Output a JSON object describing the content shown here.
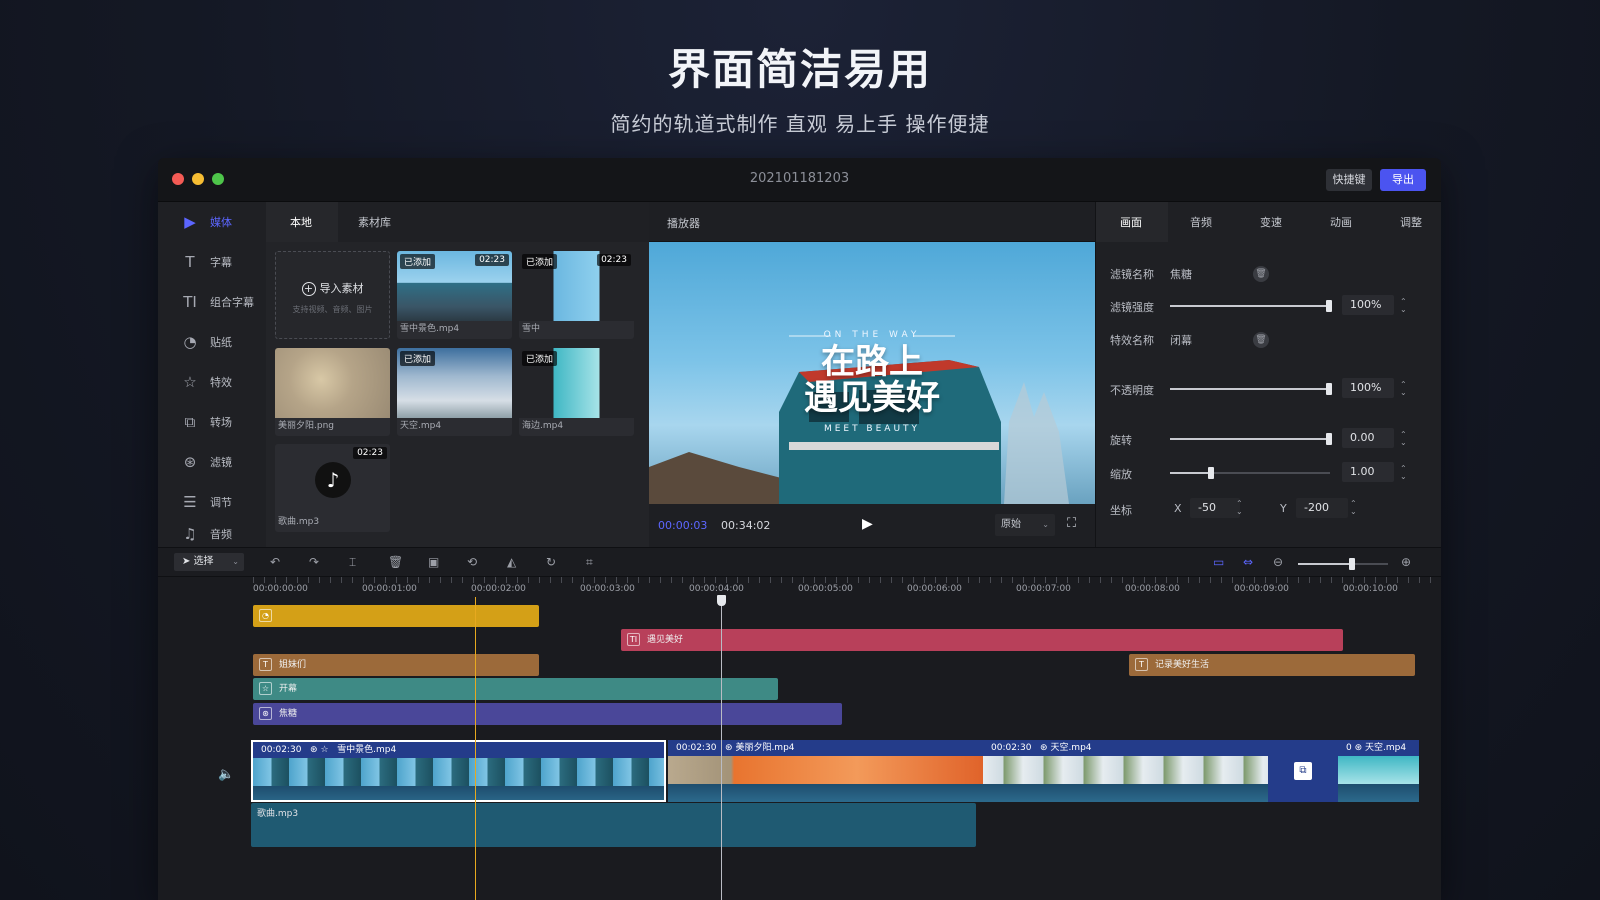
{
  "hero": {
    "title": "界面简洁易用",
    "subtitle": "简约的轨道式制作 直观 易上手 操作便捷"
  },
  "window": {
    "title": "202101181203",
    "shortcut_label": "快捷键",
    "export_label": "导出"
  },
  "sidebar": {
    "items": [
      {
        "label": "媒体",
        "icon": "play-icon",
        "active": true
      },
      {
        "label": "字幕",
        "icon": "text-icon"
      },
      {
        "label": "组合字幕",
        "icon": "combo-text-icon"
      },
      {
        "label": "贴纸",
        "icon": "sticker-icon"
      },
      {
        "label": "特效",
        "icon": "effect-star-icon"
      },
      {
        "label": "转场",
        "icon": "transition-icon"
      },
      {
        "label": "滤镜",
        "icon": "filter-icon"
      },
      {
        "label": "调节",
        "icon": "adjust-icon"
      },
      {
        "label": "音频",
        "icon": "audio-icon"
      }
    ]
  },
  "media": {
    "tabs": [
      "本地",
      "素材库"
    ],
    "import_label": "导入素材",
    "import_hint": "支持视频、音频、图片",
    "items": [
      {
        "name": "雪中景色.mp4",
        "badge": "已添加",
        "duration": "02:23"
      },
      {
        "name": "雪中",
        "badge": "已添加",
        "duration": "02:23"
      },
      {
        "name": "美丽夕阳.png"
      },
      {
        "name": "天空.mp4",
        "badge": "已添加"
      },
      {
        "name": "海边.mp4",
        "badge": "已添加"
      },
      {
        "name": "歌曲.mp3",
        "duration": "02:23"
      }
    ]
  },
  "player": {
    "title": "播放器",
    "overlay_en_top": "ON THE WAY",
    "overlay_cn_line1": "在路上",
    "overlay_cn_line2": "遇见美好",
    "overlay_en_bottom": "MEET BEAUTY",
    "current_time": "00:00:03",
    "total_time": "00:34:02",
    "ratio": "原始"
  },
  "properties": {
    "tabs": [
      "画面",
      "音频",
      "变速",
      "动画",
      "调整"
    ],
    "filter_name_label": "滤镜名称",
    "filter_name_value": "焦糖",
    "filter_strength_label": "滤镜强度",
    "filter_strength_value": "100%",
    "effect_name_label": "特效名称",
    "effect_name_value": "闭幕",
    "opacity_label": "不透明度",
    "opacity_value": "100%",
    "rotate_label": "旋转",
    "rotate_value": "0.00",
    "scale_label": "缩放",
    "scale_value": "1.00",
    "coord_label": "坐标",
    "x_label": "X",
    "x_value": "-50",
    "y_label": "Y",
    "y_value": "-200"
  },
  "toolbar": {
    "select_label": "选择"
  },
  "timeline": {
    "ruler": [
      "00:00:00:00",
      "00:00:01:00",
      "00:00:02:00",
      "00:00:03:00",
      "00:00:04:00",
      "00:00:05:00",
      "00:00:06:00",
      "00:00:07:00",
      "00:00:08:00",
      "00:00:09:00",
      "00:00:10:00"
    ],
    "sticker_clip": "",
    "title_clip": "遇见美好",
    "text_clip_1": "姐妹们",
    "text_clip_2": "记录美好生活",
    "effect_clip": "开幕",
    "filter_clip": "焦糖",
    "video_clips": [
      {
        "time": "00:02:30",
        "name": "雪中景色.mp4"
      },
      {
        "time": "00:02:30",
        "name": "美丽夕阳.mp4"
      },
      {
        "time": "00:02:30",
        "name": "天空.mp4"
      },
      {
        "time": "0",
        "name": "天空.mp4"
      }
    ],
    "audio_clip": "歌曲.mp3"
  },
  "colors": {
    "accent": "#5c66ff",
    "export": "#4b54f0",
    "sticker": "#d4a017",
    "title": "#b8405a",
    "text": "#9c6a3a",
    "effect": "#3e8a85",
    "filter": "#4a4799",
    "audio": "#1f5a72"
  }
}
